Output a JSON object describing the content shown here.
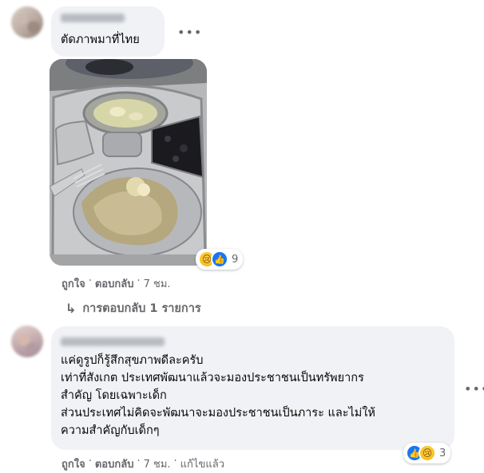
{
  "comment1": {
    "text": "ตัดภาพมาที่ไทย",
    "more_label": "•••",
    "reaction_count": "9",
    "actions": {
      "like": "ถูกใจ",
      "reply": "ตอบกลับ",
      "dot": "·",
      "time": "7 ชม."
    },
    "replies_arrow": "↳",
    "replies_label": "การตอบกลับ 1 รายการ"
  },
  "comment2": {
    "text": "แค่ดูรูปก็รู้สึกสุขภาพดีละครับ\nเท่าที่สังเกต ประเทศพัฒนาแล้วจะมองประชาชนเป็นทรัพยากร\nสำคัญ โดยเฉพาะเด็ก\nส่วนประเทศไม่คิดจะพัฒนาจะมองประชาชนเป็นภาระ และไม่ให้\nความสำคัญกับเด็กๆ",
    "more_label": "•••",
    "reaction_count": "3",
    "actions": {
      "like": "ถูกใจ",
      "reply": "ตอบกลับ",
      "dot": "·",
      "time": "7 ชม.",
      "edited": "แก้ไขแล้ว"
    }
  },
  "icons": {
    "sad": "😢",
    "like": "👍"
  },
  "colors": {
    "bubble": "#f0f2f5",
    "secondary_text": "#65676b",
    "like_blue": "#1877f2",
    "sad_yellow": "#f4b400"
  }
}
